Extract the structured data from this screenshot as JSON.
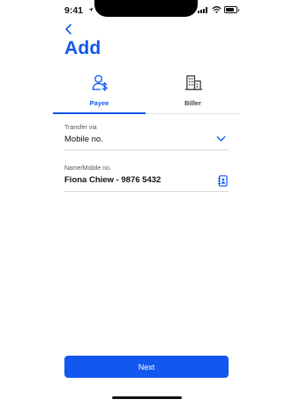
{
  "status_bar": {
    "time": "9:41",
    "icons": [
      "location-arrow-icon",
      "signal-icon",
      "wifi-icon",
      "battery-icon"
    ]
  },
  "header": {
    "back_icon": "chevron-left-icon",
    "title": "Add"
  },
  "tabs": [
    {
      "label": "Payee",
      "icon": "person-dollar-icon",
      "selected": true
    },
    {
      "label": "Biller",
      "icon": "building-icon",
      "selected": false
    }
  ],
  "form": {
    "transfer_via": {
      "label": "Transfer via",
      "value": "Mobile no.",
      "icon": "chevron-down-icon"
    },
    "name_mobile": {
      "label": "Name/Mobile no.",
      "value": "Fiona Chiew - 9876 5432",
      "icon": "contacts-book-icon"
    }
  },
  "footer": {
    "next_label": "Next"
  },
  "colors": {
    "accent": "#1257ee",
    "text": "#111111",
    "muted": "#555555",
    "divider": "#d8d8d8"
  }
}
